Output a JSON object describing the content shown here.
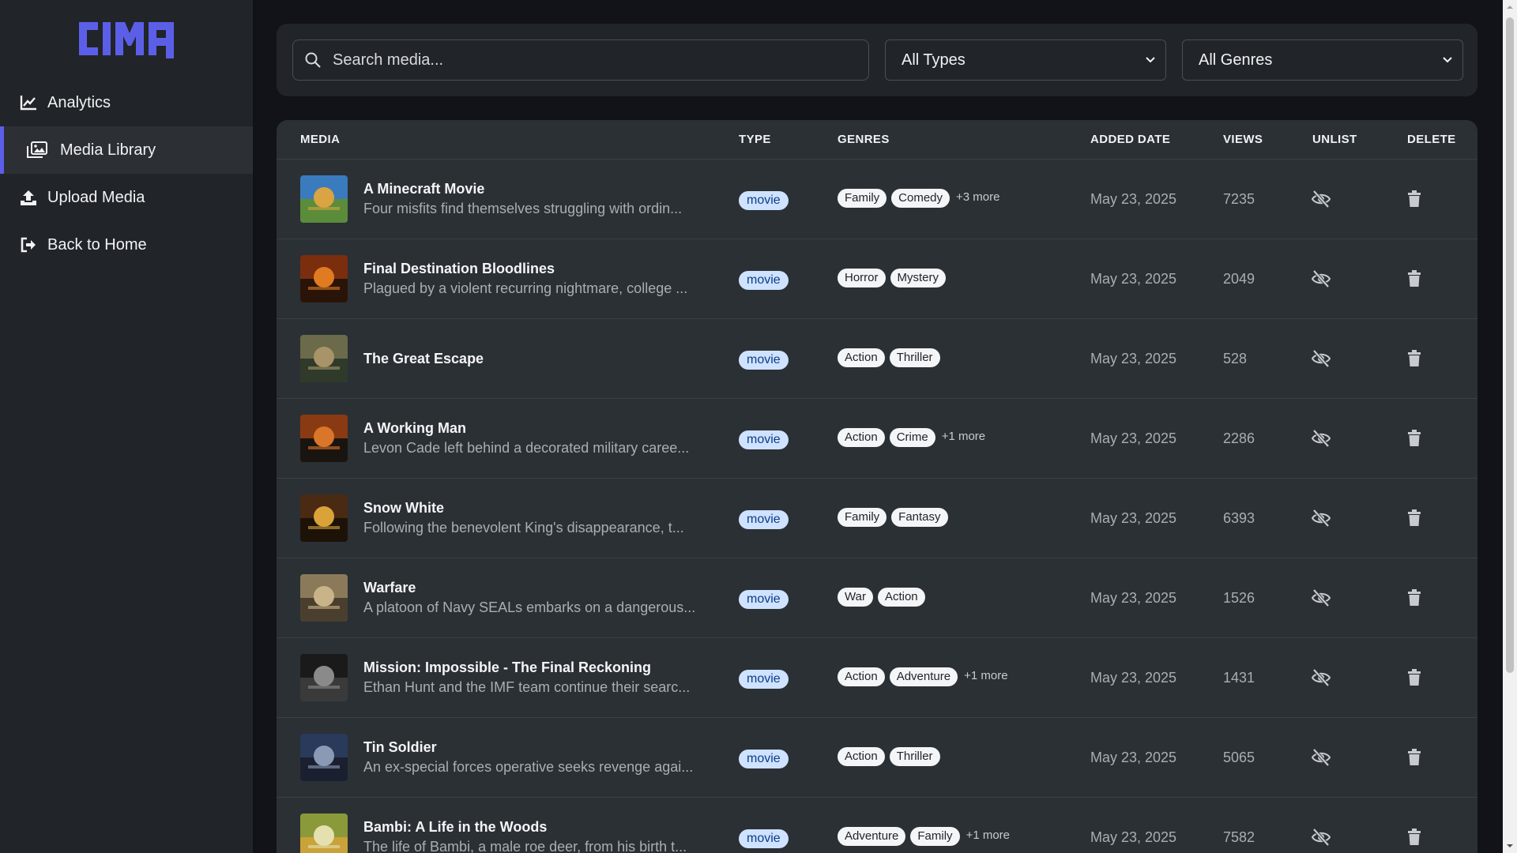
{
  "brand": {
    "logo_text": "CIMA",
    "accent": "#5b5fe8"
  },
  "sidebar": {
    "items": [
      {
        "label": "Analytics",
        "icon": "chart-line-icon"
      },
      {
        "label": "Media Library",
        "icon": "images-icon",
        "active": true
      },
      {
        "label": "Upload Media",
        "icon": "upload-icon"
      },
      {
        "label": "Back to Home",
        "icon": "sign-out-icon"
      }
    ]
  },
  "filters": {
    "search_placeholder": "Search media...",
    "type_selected": "All Types",
    "genre_selected": "All Genres"
  },
  "table": {
    "headers": [
      "MEDIA",
      "TYPE",
      "GENRES",
      "ADDED DATE",
      "VIEWS",
      "UNLIST",
      "DELETE"
    ],
    "rows": [
      {
        "title": "A Minecraft Movie",
        "desc": "Four misfits find themselves struggling with ordin...",
        "type": "movie",
        "genres": [
          "Family",
          "Comedy"
        ],
        "more": "+3 more",
        "date": "May 23, 2025",
        "views": "7235"
      },
      {
        "title": "Final Destination Bloodlines",
        "desc": "Plagued by a violent recurring nightmare, college ...",
        "type": "movie",
        "genres": [
          "Horror",
          "Mystery"
        ],
        "more": "",
        "date": "May 23, 2025",
        "views": "2049"
      },
      {
        "title": "The Great Escape",
        "desc": "",
        "type": "movie",
        "genres": [
          "Action",
          "Thriller"
        ],
        "more": "",
        "date": "May 23, 2025",
        "views": "528"
      },
      {
        "title": "A Working Man",
        "desc": "Levon Cade left behind a decorated military caree...",
        "type": "movie",
        "genres": [
          "Action",
          "Crime"
        ],
        "more": "+1 more",
        "date": "May 23, 2025",
        "views": "2286"
      },
      {
        "title": "Snow White",
        "desc": "Following the benevolent King's disappearance, t...",
        "type": "movie",
        "genres": [
          "Family",
          "Fantasy"
        ],
        "more": "",
        "date": "May 23, 2025",
        "views": "6393"
      },
      {
        "title": "Warfare",
        "desc": "A platoon of Navy SEALs embarks on a dangerous...",
        "type": "movie",
        "genres": [
          "War",
          "Action"
        ],
        "more": "",
        "date": "May 23, 2025",
        "views": "1526"
      },
      {
        "title": "Mission: Impossible - The Final Reckoning",
        "desc": "Ethan Hunt and the IMF team continue their searc...",
        "type": "movie",
        "genres": [
          "Action",
          "Adventure"
        ],
        "more": "+1 more",
        "date": "May 23, 2025",
        "views": "1431"
      },
      {
        "title": "Tin Soldier",
        "desc": "An ex-special forces operative seeks revenge agai...",
        "type": "movie",
        "genres": [
          "Action",
          "Thriller"
        ],
        "more": "",
        "date": "May 23, 2025",
        "views": "5065"
      },
      {
        "title": "Bambi: A Life in the Woods",
        "desc": "The life of Bambi, a male roe deer, from his birth t...",
        "type": "movie",
        "genres": [
          "Adventure",
          "Family"
        ],
        "more": "+1 more",
        "date": "May 23, 2025",
        "views": "7582"
      }
    ]
  }
}
